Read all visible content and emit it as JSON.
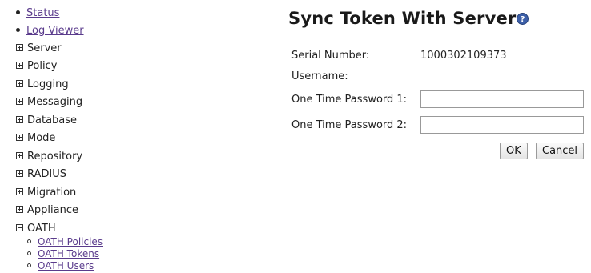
{
  "sidebar": {
    "links": [
      {
        "label": "Status"
      },
      {
        "label": "Log Viewer"
      }
    ],
    "tree": [
      {
        "label": "Server"
      },
      {
        "label": "Policy"
      },
      {
        "label": "Logging"
      },
      {
        "label": "Messaging"
      },
      {
        "label": "Database"
      },
      {
        "label": "Mode"
      },
      {
        "label": "Repository"
      },
      {
        "label": "RADIUS"
      },
      {
        "label": "Migration"
      },
      {
        "label": "Appliance"
      }
    ],
    "expanded": {
      "label": "OATH",
      "children": [
        {
          "label": "OATH Policies"
        },
        {
          "label": "OATH Tokens"
        },
        {
          "label": "OATH Users"
        }
      ]
    }
  },
  "main": {
    "title": "Sync Token With Server",
    "help_icon": "?",
    "form": {
      "serial_label": "Serial Number:",
      "serial_value": "1000302109373",
      "username_label": "Username:",
      "username_value": "",
      "otp1_label": "One Time Password 1:",
      "otp1_value": "",
      "otp2_label": "One Time Password 2:",
      "otp2_value": ""
    },
    "buttons": {
      "ok": "OK",
      "cancel": "Cancel"
    }
  }
}
